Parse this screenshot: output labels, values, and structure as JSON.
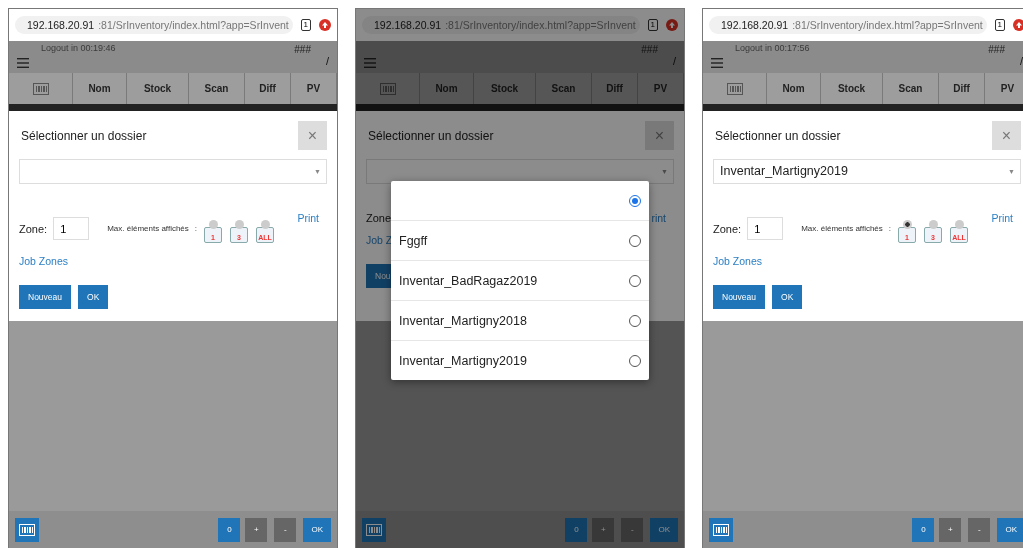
{
  "phones": [
    {
      "url": {
        "host": "192.168.20.91",
        "rest": ":81/SrInventory/index.html?app=SrInvent",
        "tabs": "1"
      },
      "header": {
        "logout": "Logout in 00:19:46",
        "hash": "###",
        "slash": "/"
      },
      "columns": [
        "Nom",
        "Stock",
        "Scan",
        "Diff",
        "PV"
      ],
      "dimmed": false,
      "dialog": {
        "title": "Sélectionner un dossier",
        "close": "×",
        "caret": "▼",
        "zone_label": "Zone:",
        "zone_value": "1",
        "max_label": "Max. éléments affichés",
        "max_colon": ":",
        "max_options": [
          {
            "label": "1",
            "selected": false
          },
          {
            "label": "3",
            "selected": false
          },
          {
            "label": "ALL",
            "selected": false
          }
        ],
        "print": "Print",
        "job_zones": "Job Zones",
        "buttons": [
          "Nouveau",
          "OK"
        ]
      },
      "bottom": {
        "count": "0",
        "plus": "+",
        "minus": "-",
        "ok": "OK"
      }
    },
    {
      "url": {
        "host": "192.168.20.91",
        "rest": ":81/SrInventory/index.html?app=SrInvent",
        "tabs": "1"
      },
      "header": {
        "hash": "###",
        "slash": "/"
      },
      "columns": [
        "Nom",
        "Stock",
        "Scan",
        "Diff",
        "PV"
      ],
      "dimmed": true,
      "dialog": {
        "title": "Sélectionner un dossier",
        "close": "×",
        "caret": "▼",
        "zone_label": "Zone",
        "print": "rint",
        "job_zones": "Job Z",
        "buttons": [
          "Nou"
        ]
      },
      "picker": [
        {
          "selected": true
        },
        {
          "label": "Fggff",
          "selected": false
        },
        {
          "label": "Inventar_BadRagaz2019",
          "selected": false
        },
        {
          "label": "Inventar_Martigny2018",
          "selected": false
        },
        {
          "label": "Inventar_Martigny2019",
          "selected": false
        }
      ],
      "bottom": {
        "count": "0",
        "plus": "+",
        "minus": "-",
        "ok": "OK"
      }
    },
    {
      "url": {
        "host": "192.168.20.91",
        "rest": ":81/SrInventory/index.html?app=SrInvent",
        "tabs": "1"
      },
      "header": {
        "logout": "Logout in 00:17:56",
        "hash": "###",
        "slash": "/"
      },
      "columns": [
        "Nom",
        "Stock",
        "Scan",
        "Diff",
        "PV"
      ],
      "dimmed": false,
      "dialog": {
        "title": "Sélectionner un dossier",
        "close": "×",
        "caret": "▼",
        "select_value": "Inventar_Martigny2019",
        "zone_label": "Zone:",
        "zone_value": "1",
        "max_label": "Max. éléments affichés",
        "max_colon": ":",
        "max_options": [
          {
            "label": "1",
            "selected": true
          },
          {
            "label": "3",
            "selected": false
          },
          {
            "label": "ALL",
            "selected": false
          }
        ],
        "print": "Print",
        "job_zones": "Job Zones",
        "buttons": [
          "Nouveau",
          "OK"
        ]
      },
      "bottom": {
        "count": "0",
        "plus": "+",
        "minus": "-",
        "ok": "OK"
      }
    }
  ]
}
